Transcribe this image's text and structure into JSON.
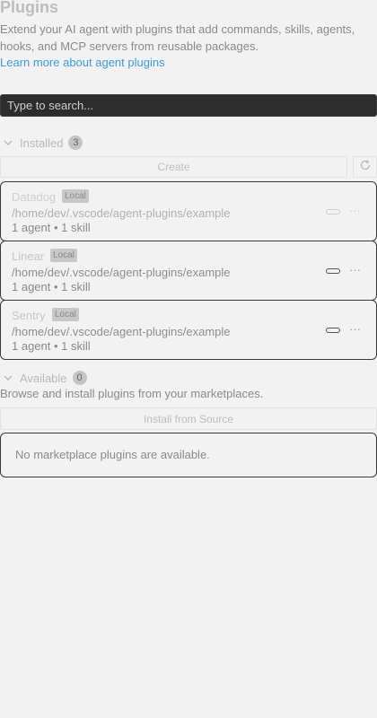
{
  "header": {
    "title": "Plugins",
    "description": "Extend your AI agent with plugins that add commands, skills, agents, hooks, and MCP servers from reusable packages.",
    "learn_more": "Learn more about agent plugins"
  },
  "search": {
    "placeholder": "Type to search..."
  },
  "installed": {
    "label": "Installed",
    "count": "3",
    "create_label": "Create",
    "plugins": [
      {
        "name": "Datadog",
        "badge": "Local",
        "path": "/home/dev/.vscode/agent-plugins/example",
        "meta": "1 agent • 1 skill",
        "enabled": false
      },
      {
        "name": "Linear",
        "badge": "Local",
        "path": "/home/dev/.vscode/agent-plugins/example",
        "meta": "1 agent • 1 skill",
        "enabled": true
      },
      {
        "name": "Sentry",
        "badge": "Local",
        "path": "/home/dev/.vscode/agent-plugins/example",
        "meta": "1 agent • 1 skill",
        "enabled": true
      }
    ],
    "more_label": "···"
  },
  "available": {
    "label": "Available",
    "count": "0",
    "description": "Browse and install plugins from your marketplaces.",
    "install_label": "Install from Source",
    "empty_text": "No marketplace plugins are available."
  },
  "icons": {
    "chevron": "chevron-down-icon",
    "refresh": "refresh-icon",
    "toggle": "toggle-switch-icon",
    "more": "more-horizontal-icon"
  },
  "colors": {
    "link": "#3a9be0",
    "search_bg": "#2d2d2d",
    "card_border": "#3a3a3a",
    "background": "#f2f2f2"
  }
}
